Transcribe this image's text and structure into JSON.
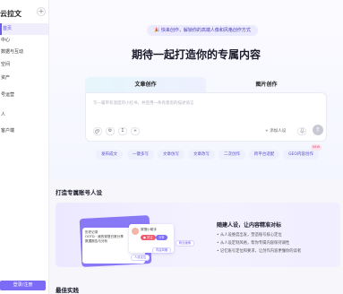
{
  "sidebar": {
    "logo": "云拉文",
    "plus": "+",
    "items": [
      {
        "label": "首页",
        "active": true
      },
      {
        "label": "中心",
        "active": false
      },
      {
        "label": "数据与互动",
        "active": false
      },
      {
        "label": "空间",
        "active": false
      },
      {
        "label": "资产",
        "active": false
      },
      {
        "label": "号运营",
        "active": false
      },
      {
        "label": "人",
        "active": false
      },
      {
        "label": "客户端",
        "active": false
      }
    ],
    "login": "登录/注册"
  },
  "hero": {
    "banner": "🎉 快来创作，解锁你的高端人像和风格创作方式",
    "headline": "期待一起打造你的专属内容",
    "tabs": [
      "文章创作",
      "图片创作"
    ],
    "input_placeholder": "写一篇带有温度的小红书，并且用一条有意思的描述语言",
    "tools": [
      "⚙",
      "Σ",
      "+"
    ],
    "slot_button": "+ 添加人设",
    "send": "↑",
    "chips": [
      "发布成文",
      "一键多写",
      "文章仿写",
      "文章改写",
      "二次创作",
      "跨平台适配",
      "GEO内容创作"
    ],
    "new_badge": "NEW"
  },
  "persona_section": {
    "title": "打造专属账号人设",
    "mock": {
      "panel_lines": [
        "历史记录",
        "OOTD · 我的穿搭日常分享",
        "数据报告与分析"
      ],
      "profile_name": "穿搭小助手",
      "pill_red": "● 关注",
      "pill_purple": "分享",
      "tags": [
        "人设定位",
        "内容风格",
        "粉丝画像"
      ]
    },
    "feature_title": "随建人设，让内容精准对标",
    "features": [
      "• 从人设维度出发，塑造账号核心定位",
      "• 从人设定制风格，帮你专属内容保持调性",
      "• 记忆账号定位和要求，让创作内容更懂你的读者"
    ]
  },
  "best_section": {
    "title": "最佳实践"
  },
  "colors": {
    "accent": "#7c6cf5",
    "active_bg": "#f0eefc",
    "chip_bg": "#eef0fe"
  }
}
